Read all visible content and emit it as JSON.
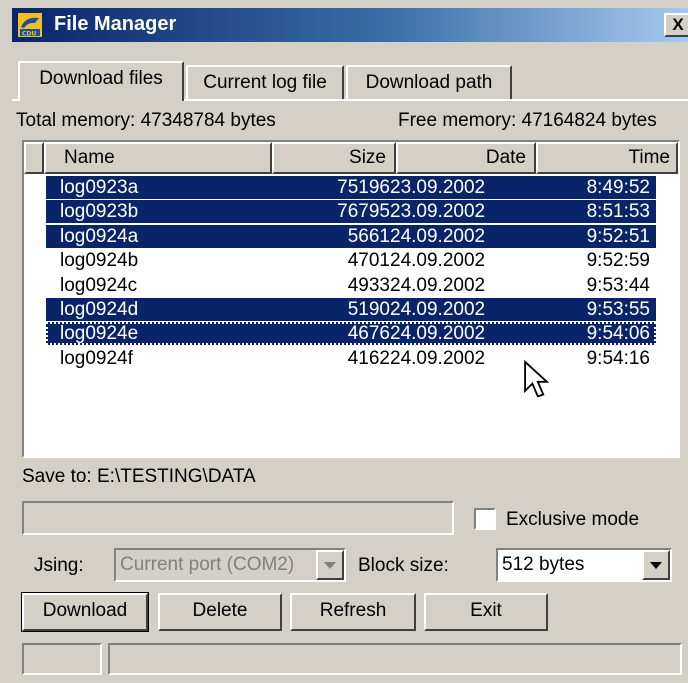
{
  "window": {
    "title": "File Manager",
    "close_label": "X",
    "icon": "app-icon"
  },
  "tabs": [
    {
      "label": "Download files",
      "active": true
    },
    {
      "label": "Current log file",
      "active": false
    },
    {
      "label": "Download path",
      "active": false
    }
  ],
  "memory": {
    "total": "Total memory: 47348784 bytes",
    "free": "Free memory: 47164824 bytes"
  },
  "columns": [
    "Name",
    "Size",
    "Date",
    "Time"
  ],
  "files": [
    {
      "name": "log0923a",
      "size": "75196",
      "date": "23.09.2002",
      "time": "8:49:52",
      "selected": true
    },
    {
      "name": "log0923b",
      "size": "76795",
      "date": "23.09.2002",
      "time": "8:51:53",
      "selected": true
    },
    {
      "name": "log0924a",
      "size": "5661",
      "date": "24.09.2002",
      "time": "9:52:51",
      "selected": true
    },
    {
      "name": "log0924b",
      "size": "4701",
      "date": "24.09.2002",
      "time": "9:52:59",
      "selected": false
    },
    {
      "name": "log0924c",
      "size": "4933",
      "date": "24.09.2002",
      "time": "9:53:44",
      "selected": false
    },
    {
      "name": "log0924d",
      "size": "5190",
      "date": "24.09.2002",
      "time": "9:53:55",
      "selected": true
    },
    {
      "name": "log0924e",
      "size": "4676",
      "date": "24.09.2002",
      "time": "9:54:06",
      "selected": true,
      "focused": true
    },
    {
      "name": "log0924f",
      "size": "4162",
      "date": "24.09.2002",
      "time": "9:54:16",
      "selected": false
    }
  ],
  "save_to": "Save to: E:\\TESTING\\DATA",
  "exclusive_mode": {
    "label": "Exclusive mode",
    "checked": false
  },
  "using": {
    "label": "Jsing:",
    "value": "Current port (COM2)",
    "disabled": true
  },
  "block_size": {
    "label": "Block size:",
    "value": "512 bytes"
  },
  "buttons": {
    "download": "Download",
    "delete": "Delete",
    "refresh": "Refresh",
    "exit": "Exit"
  },
  "colors": {
    "selection": "#0a246a",
    "face": "#d4d0c8",
    "title_gradient_start": "#0a246a"
  }
}
